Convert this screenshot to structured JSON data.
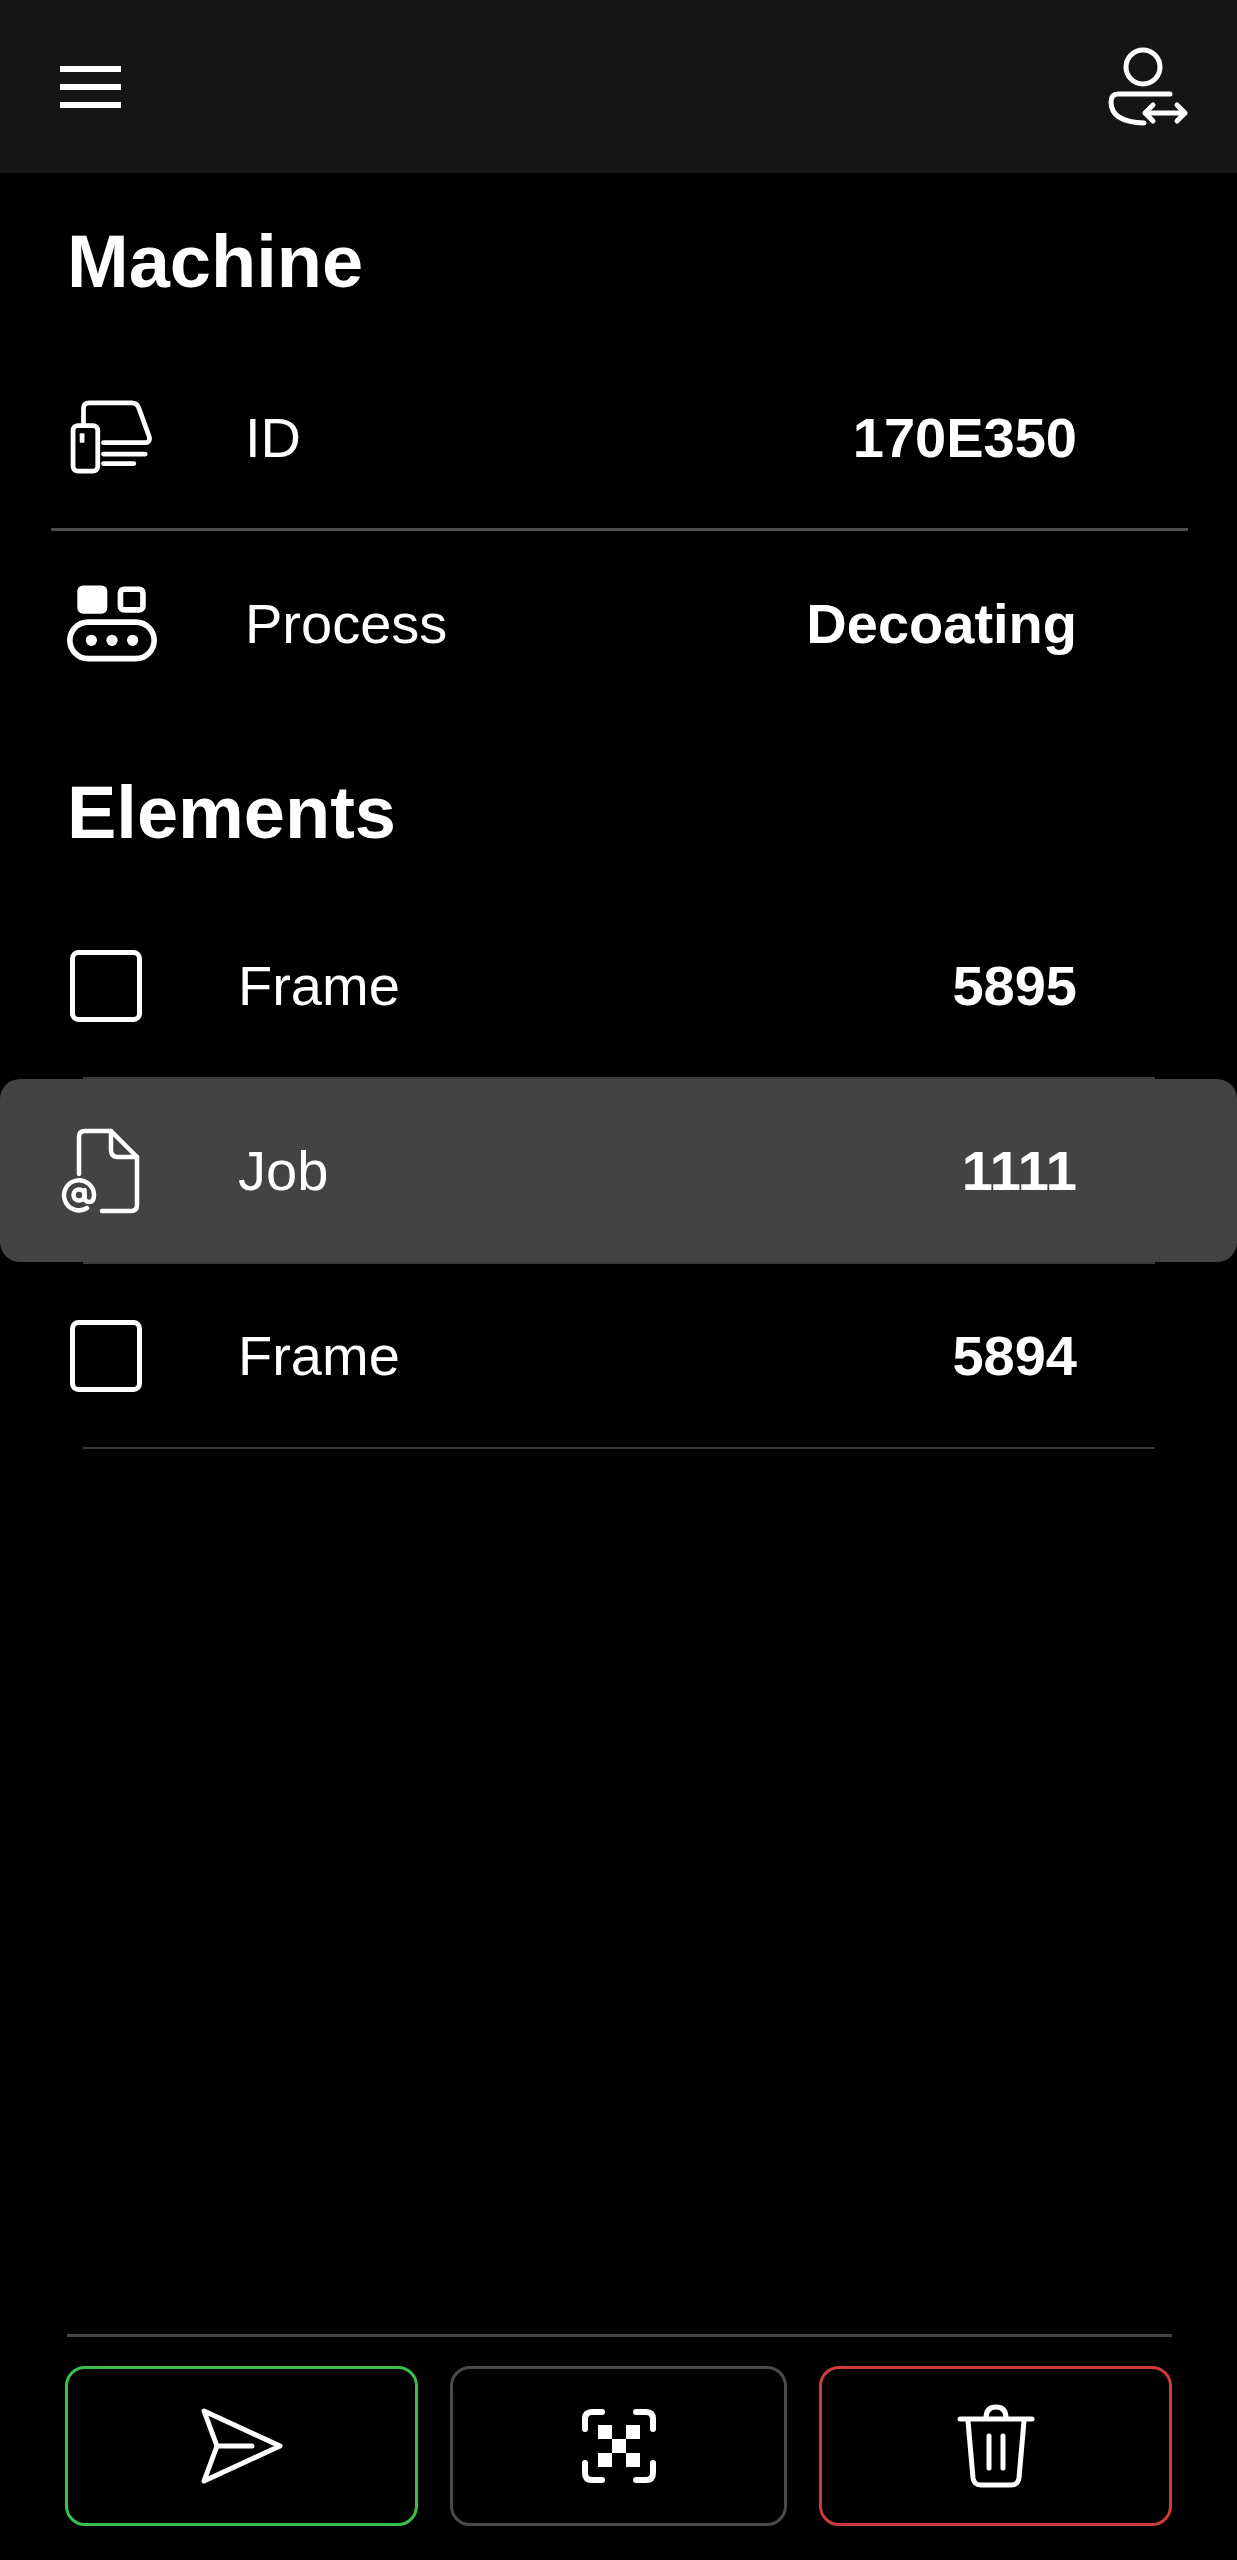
{
  "machine": {
    "title": "Machine",
    "rows": [
      {
        "kind": "device",
        "label": "ID",
        "value": "170E350"
      },
      {
        "kind": "conveyor",
        "label": "Process",
        "value": "Decoating"
      }
    ]
  },
  "elements": {
    "title": "Elements",
    "items": [
      {
        "kind": "frame",
        "label": "Frame",
        "value": "5895",
        "selected": false
      },
      {
        "kind": "job",
        "label": "Job",
        "value": "1111",
        "selected": true
      },
      {
        "kind": "frame",
        "label": "Frame",
        "value": "5894",
        "selected": false
      }
    ]
  },
  "actions": [
    {
      "kind": "send"
    },
    {
      "kind": "scan"
    },
    {
      "kind": "delete"
    }
  ]
}
